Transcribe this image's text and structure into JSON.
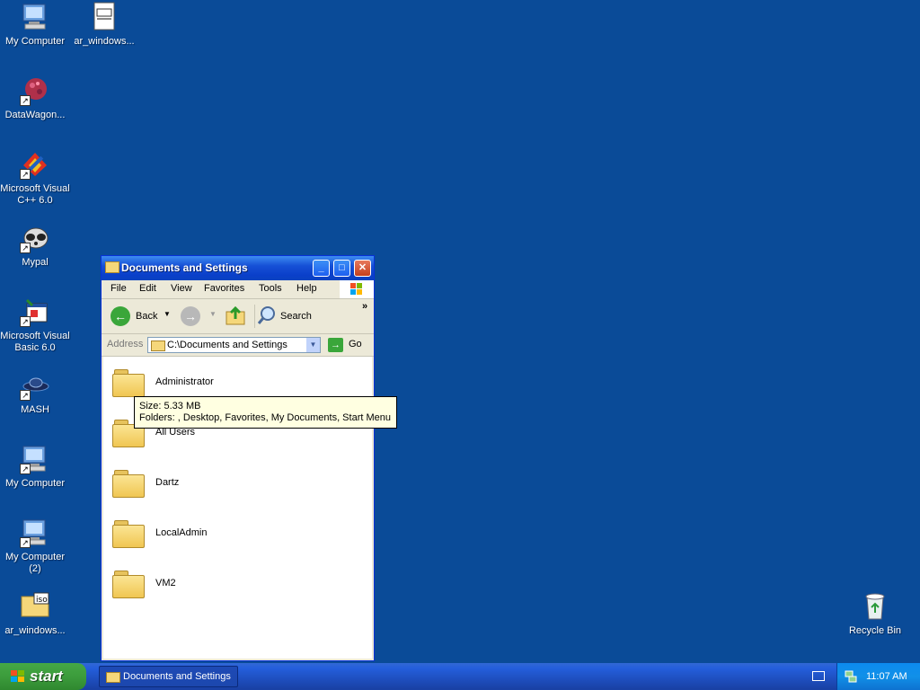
{
  "desktop": {
    "icons": [
      {
        "label": "My Computer",
        "icon": "my-computer-icon"
      },
      {
        "label": "ar_windows...",
        "icon": "document-icon"
      },
      {
        "label": "DataWagon...",
        "icon": "datawagon-icon"
      },
      {
        "label": "Microsoft Visual C++ 6.0",
        "icon": "visual-cpp-icon"
      },
      {
        "label": "Mypal",
        "icon": "mypal-icon"
      },
      {
        "label": "Microsoft Visual Basic 6.0",
        "icon": "visual-basic-icon"
      },
      {
        "label": "MASH",
        "icon": "mash-icon"
      },
      {
        "label": "My Computer",
        "icon": "my-computer-icon"
      },
      {
        "label": "My Computer (2)",
        "icon": "my-computer-icon"
      },
      {
        "label": "ar_windows...",
        "icon": "iso-icon"
      },
      {
        "label": "Recycle Bin",
        "icon": "recycle-bin-icon"
      }
    ]
  },
  "window": {
    "title": "Documents and Settings",
    "menu": [
      "File",
      "Edit",
      "View",
      "Favorites",
      "Tools",
      "Help"
    ],
    "toolbar": {
      "back": "Back",
      "search": "Search",
      "overflow": "»"
    },
    "address": {
      "label": "Address",
      "value": "C:\\Documents and Settings",
      "go": "Go"
    },
    "folders": [
      "Administrator",
      "All Users",
      "Dartz",
      "LocalAdmin",
      "VM2"
    ]
  },
  "tooltip": {
    "size": "Size: 5.33 MB",
    "folders": "Folders: , Desktop, Favorites, My Documents, Start Menu"
  },
  "taskbar": {
    "start": "start",
    "task": "Documents and Settings",
    "time": "11:07 AM"
  },
  "colors": {
    "desktop": "#0a4b98",
    "titlebar": "#0a43c0",
    "start": "#3c9c3c",
    "tooltip": "#ffffe1"
  }
}
